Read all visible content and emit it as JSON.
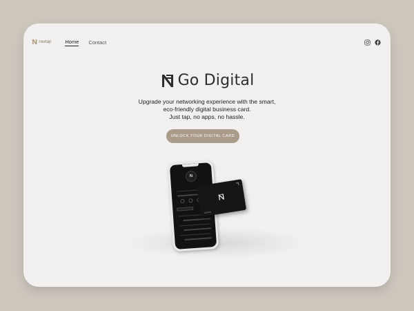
{
  "nav": {
    "logo_mark": "N",
    "logo_text": "nextap",
    "links": [
      "Home",
      "Contact"
    ],
    "social_icons": [
      "instagram-icon",
      "facebook-icon"
    ]
  },
  "hero": {
    "title": "Go Digital",
    "subtitle_lines": [
      "Upgrade your networking experience with the smart,",
      "eco-friendly digital business card.",
      "Just tap, no apps, no hassle."
    ],
    "cta_label": "UNLOCK YOUR DIGITAL CARD"
  },
  "colors": {
    "page_bg": "#ccc6bd",
    "card_bg": "#f1f0ee",
    "accent": "#ab9b8b",
    "logo": "#b49e86"
  }
}
